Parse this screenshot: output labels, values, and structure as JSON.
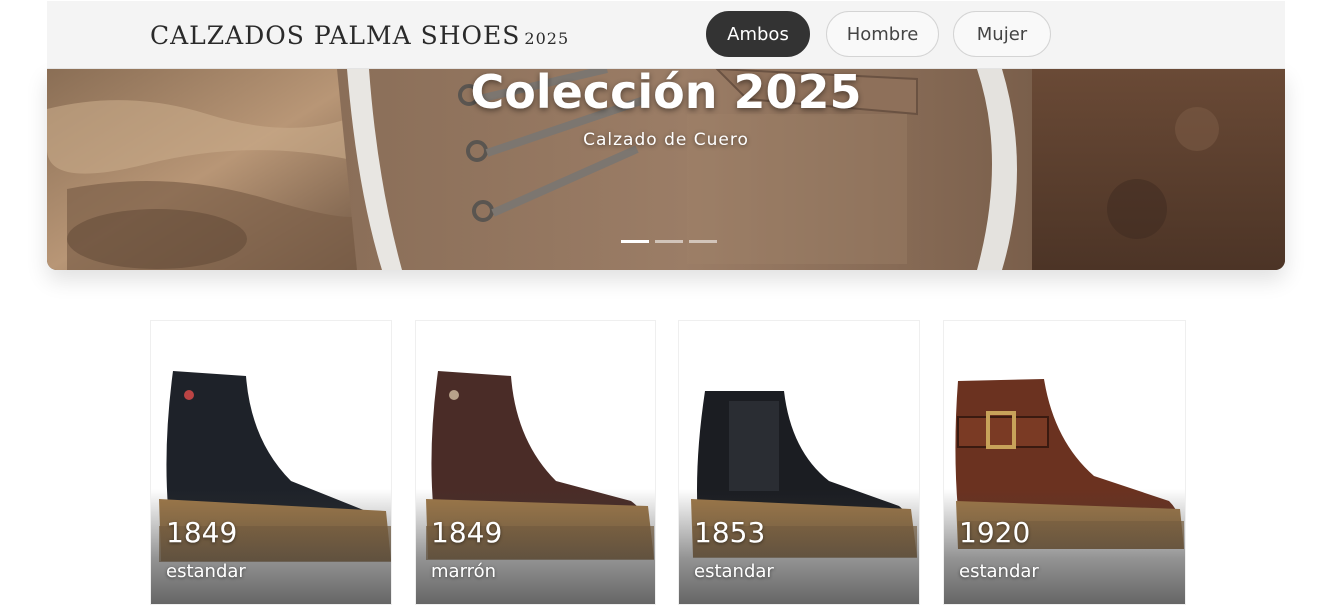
{
  "header": {
    "brand": "CALZADOS PALMA SHOES",
    "brand_year": "2025",
    "filters": [
      {
        "label": "Ambos",
        "active": true
      },
      {
        "label": "Hombre",
        "active": false
      },
      {
        "label": "Mujer",
        "active": false
      }
    ]
  },
  "hero": {
    "title": "Colección 2025",
    "subtitle": "Calzado de Cuero",
    "slides": 3,
    "active_slide": 1
  },
  "products": [
    {
      "code": "1849",
      "color": "estandar",
      "boot_color": "#1e2229"
    },
    {
      "code": "1849",
      "color": "marrón",
      "boot_color": "#4a2c27"
    },
    {
      "code": "1853",
      "color": "estandar",
      "boot_color": "#1b1d22"
    },
    {
      "code": "1920",
      "color": "estandar",
      "boot_color": "#6b3220"
    }
  ],
  "colors": {
    "active_pill": "#333333",
    "header_bg": "#f4f4f4",
    "sole": "#a07a4a"
  }
}
